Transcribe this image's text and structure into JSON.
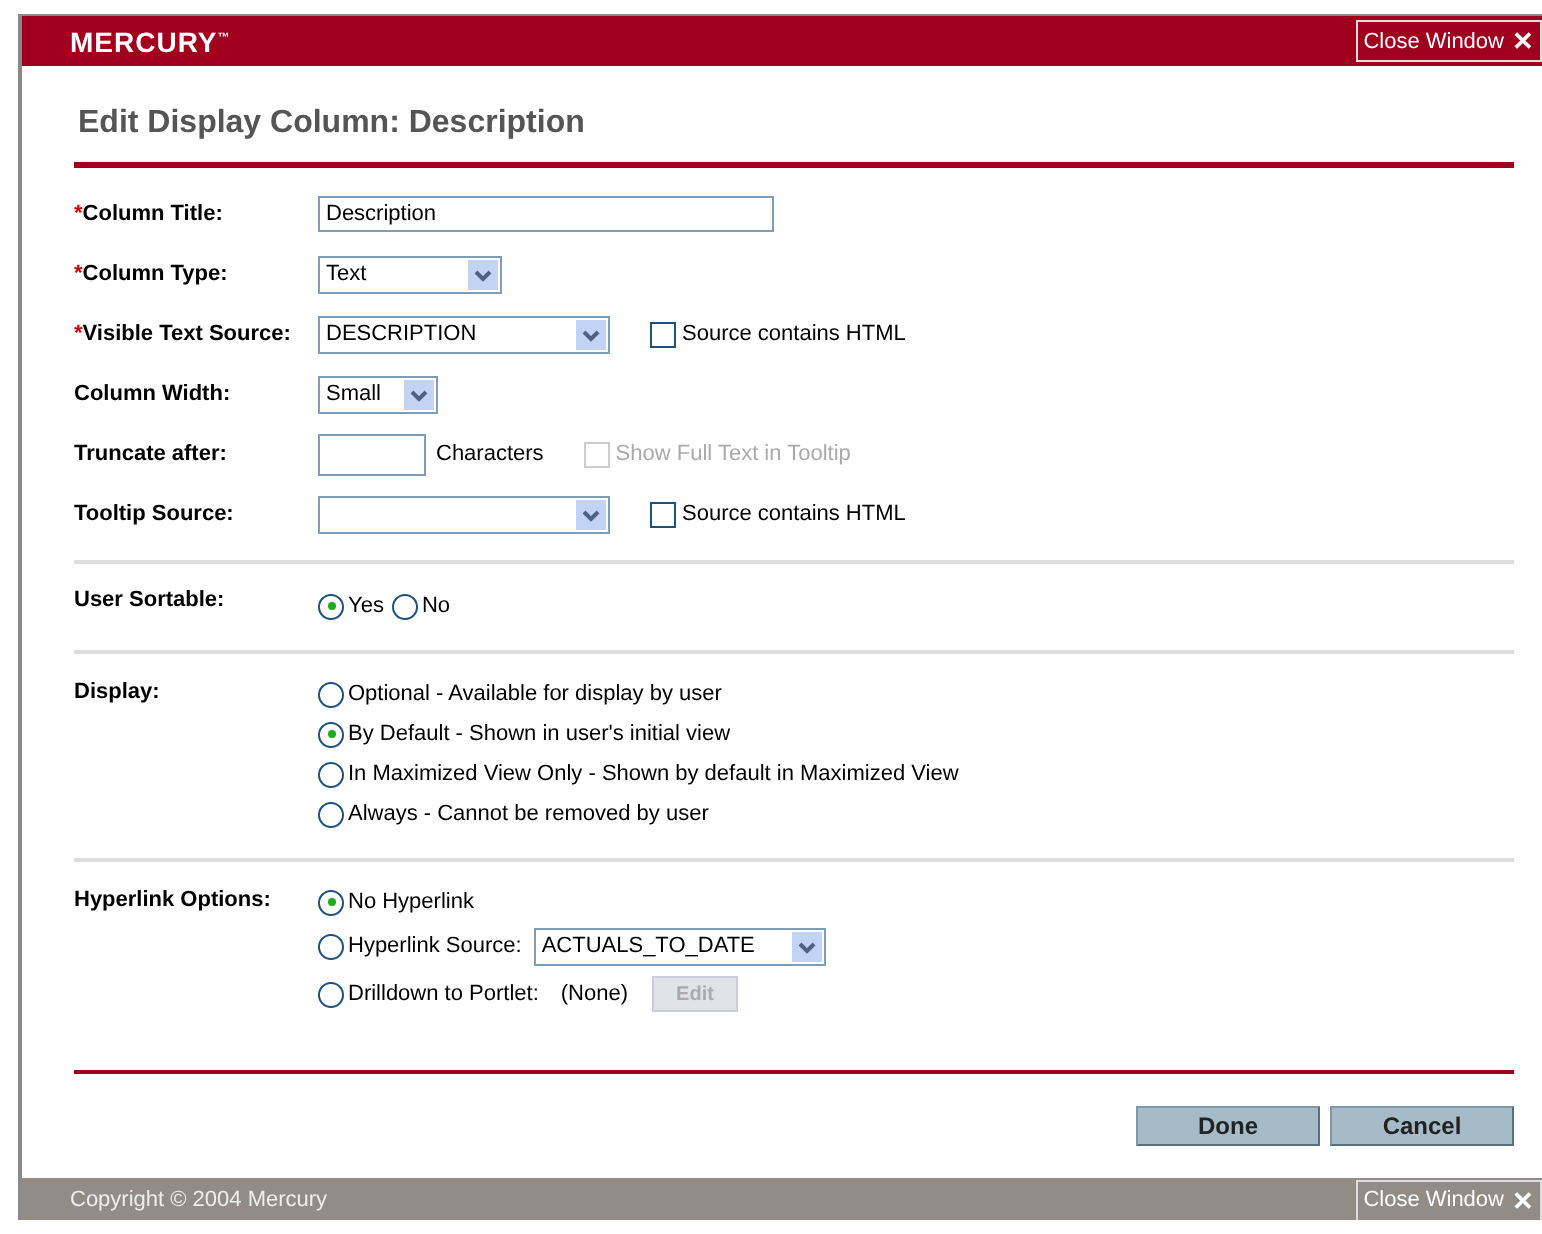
{
  "header": {
    "logo": "MERCURY$^{™}$",
    "close": {
      "label": "Close Window",
      "glyph": "✕"
    }
  },
  "page_title": "Edit Display Column: Description",
  "fields": [
    {
      "kind": "text",
      "required_mark": "*",
      "label": "Column Title:",
      "value": "Description"
    },
    {
      "kind": "select",
      "required_mark": "*",
      "label": "Column Type:",
      "value": "Text"
    },
    {
      "kind": "select",
      "required_mark": "*",
      "label": "Visible Text Source:",
      "value": "DESCRIPTION",
      "checkbox": {
        "label": "Source contains HTML",
        "checked": false,
        "disabled": false
      }
    },
    {
      "kind": "select",
      "label": "Column Width:",
      "value": "Small"
    },
    {
      "kind": "number",
      "label": "Truncate after:",
      "unit": "Characters",
      "checkbox": {
        "label": "Show Full Text in Tooltip",
        "checked": false,
        "disabled": true
      }
    },
    {
      "kind": "select",
      "label": "Tooltip Source:",
      "checkbox": {
        "label": "Source contains HTML",
        "checked": false,
        "disabled": false
      }
    }
  ],
  "radio_groups": [
    {
      "label": "User Sortable:",
      "kind": "inline",
      "options": [
        {
          "label": "Yes",
          "selected": true
        },
        {
          "label": "No",
          "selected": false
        }
      ]
    },
    {
      "label": "Display:",
      "kind": "stacked",
      "options": [
        {
          "label": "Optional - Available for display by user",
          "selected": false
        },
        {
          "label": "By Default - Shown in user's initial view",
          "selected": true
        },
        {
          "label": "In Maximized View Only - Shown by default in Maximized View",
          "selected": false
        },
        {
          "label": "Always - Cannot be removed by user",
          "selected": false
        }
      ]
    },
    {
      "label": "Hyperlink Options:",
      "kind": "stacked",
      "options": [
        {
          "label": "No Hyperlink",
          "selected": true
        },
        {
          "label": "Hyperlink Source:",
          "selected": false,
          "select_value": "ACTUALS_TO_DATE"
        },
        {
          "label": "Drilldown to Portlet:",
          "selected": false,
          "value_text": "(None)",
          "button": {
            "label": "Edit",
            "disabled": true
          }
        }
      ]
    }
  ],
  "buttons": [
    "Done",
    "Cancel"
  ],
  "footer": {
    "copyright": "Copyright © 2004 Mercury",
    "close": {
      "label": "Close Window",
      "glyph": "✕"
    }
  }
}
